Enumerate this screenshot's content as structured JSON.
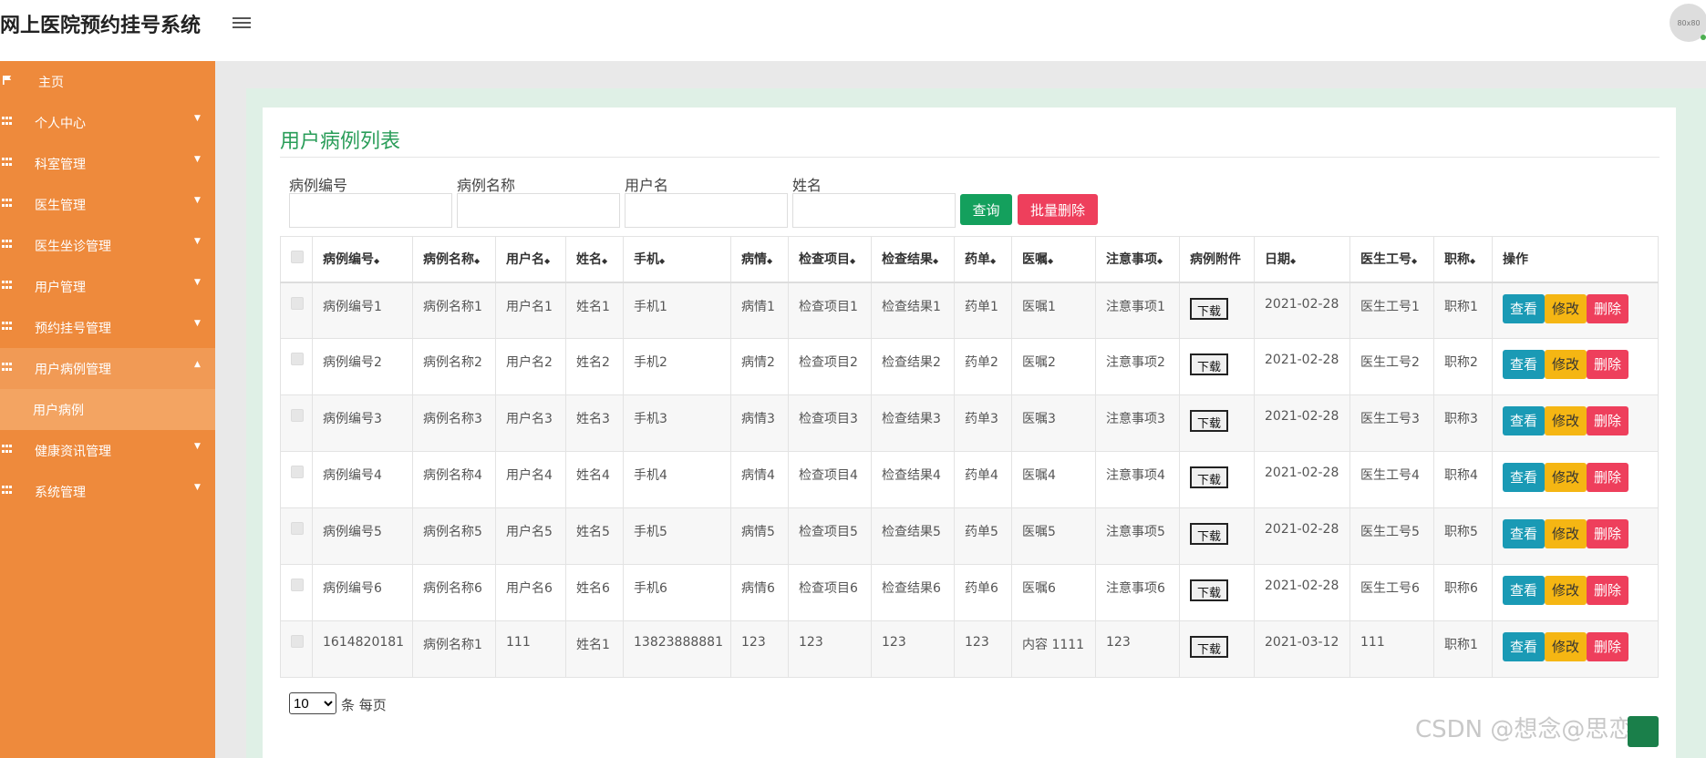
{
  "header": {
    "title": "网上医院预约挂号系统",
    "avatar_text": "80x80"
  },
  "sidebar": {
    "items": [
      {
        "label": "主页",
        "icon": "flag-icon"
      },
      {
        "label": "个人中心",
        "icon": "grid-icon"
      },
      {
        "label": "科室管理",
        "icon": "grid-icon"
      },
      {
        "label": "医生管理",
        "icon": "grid-icon"
      },
      {
        "label": "医生坐诊管理",
        "icon": "grid-icon"
      },
      {
        "label": "用户管理",
        "icon": "grid-icon"
      },
      {
        "label": "预约挂号管理",
        "icon": "grid-icon"
      },
      {
        "label": "用户病例管理",
        "icon": "grid-icon"
      },
      {
        "label": "健康资讯管理",
        "icon": "grid-icon"
      },
      {
        "label": "系统管理",
        "icon": "grid-icon"
      }
    ],
    "subitem": "用户病例"
  },
  "panel": {
    "title": "用户病例列表"
  },
  "filters": {
    "case_no_label": "病例编号",
    "case_name_label": "病例名称",
    "username_label": "用户名",
    "name_label": "姓名",
    "query_button": "查询",
    "batch_delete_button": "批量删除"
  },
  "table": {
    "headers": [
      "病例编号",
      "病例名称",
      "用户名",
      "姓名",
      "手机",
      "病情",
      "检查项目",
      "检查结果",
      "药单",
      "医嘱",
      "注意事项",
      "病例附件",
      "日期",
      "医生工号",
      "职称",
      "操作"
    ],
    "download_label": "下载",
    "view_label": "查看",
    "edit_label": "修改",
    "delete_label": "删除",
    "rows": [
      [
        "病例编号1",
        "病例名称1",
        "用户名1",
        "姓名1",
        "手机1",
        "病情1",
        "检查项目1",
        "检查结果1",
        "药单1",
        "医嘱1",
        "注意事项1",
        "2021-02-28",
        "医生工号1",
        "职称1"
      ],
      [
        "病例编号2",
        "病例名称2",
        "用户名2",
        "姓名2",
        "手机2",
        "病情2",
        "检查项目2",
        "检查结果2",
        "药单2",
        "医嘱2",
        "注意事项2",
        "2021-02-28",
        "医生工号2",
        "职称2"
      ],
      [
        "病例编号3",
        "病例名称3",
        "用户名3",
        "姓名3",
        "手机3",
        "病情3",
        "检查项目3",
        "检查结果3",
        "药单3",
        "医嘱3",
        "注意事项3",
        "2021-02-28",
        "医生工号3",
        "职称3"
      ],
      [
        "病例编号4",
        "病例名称4",
        "用户名4",
        "姓名4",
        "手机4",
        "病情4",
        "检查项目4",
        "检查结果4",
        "药单4",
        "医嘱4",
        "注意事项4",
        "2021-02-28",
        "医生工号4",
        "职称4"
      ],
      [
        "病例编号5",
        "病例名称5",
        "用户名5",
        "姓名5",
        "手机5",
        "病情5",
        "检查项目5",
        "检查结果5",
        "药单5",
        "医嘱5",
        "注意事项5",
        "2021-02-28",
        "医生工号5",
        "职称5"
      ],
      [
        "病例编号6",
        "病例名称6",
        "用户名6",
        "姓名6",
        "手机6",
        "病情6",
        "检查项目6",
        "检查结果6",
        "药单6",
        "医嘱6",
        "注意事项6",
        "2021-02-28",
        "医生工号6",
        "职称6"
      ],
      [
        "1614820181",
        "病例名称1",
        "111",
        "姓名1",
        "13823888881",
        "123",
        "123",
        "123",
        "123",
        "内容 1111",
        "123",
        "2021-03-12",
        "111",
        "职称1"
      ]
    ]
  },
  "pagination": {
    "page_size": "10",
    "page_size_suffix": "条 每页"
  },
  "watermark": "CSDN @想念@思恋"
}
